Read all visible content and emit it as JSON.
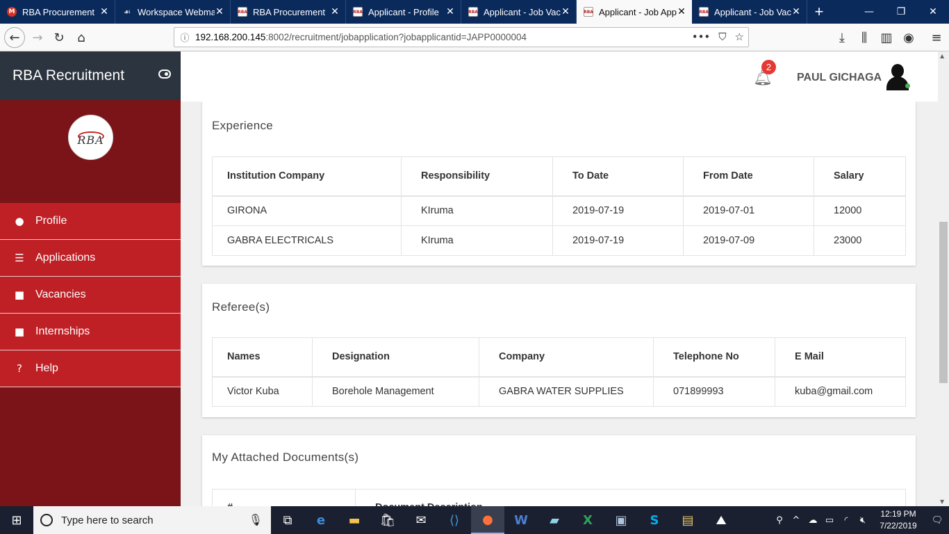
{
  "browser": {
    "tabs": [
      {
        "title": "RBA Procurement",
        "icon": "mail-icon"
      },
      {
        "title": "Workspace Webmail",
        "icon": "webmail-icon"
      },
      {
        "title": "RBA Procurement",
        "icon": "rba-favicon"
      },
      {
        "title": "Applicant - Profile",
        "icon": "rba-favicon"
      },
      {
        "title": "Applicant - Job Vacancy",
        "icon": "rba-favicon"
      },
      {
        "title": "Applicant - Job Application",
        "icon": "rba-favicon",
        "active": true
      },
      {
        "title": "Applicant - Job Vacancy",
        "icon": "rba-favicon"
      }
    ],
    "url_host": "192.168.200.145",
    "url_rest": ":8002/recruitment/jobapplication?jobapplicantid=JAPP0000004"
  },
  "sidebar": {
    "title": "RBA Recruitment",
    "logo_text": "RBA",
    "items": [
      {
        "label": "Profile",
        "icon": "user-circle-icon"
      },
      {
        "label": "Applications",
        "icon": "list-icon"
      },
      {
        "label": "Vacancies",
        "icon": "briefcase-icon"
      },
      {
        "label": "Internships",
        "icon": "briefcase-icon"
      },
      {
        "label": "Help",
        "icon": "question-circle-icon"
      }
    ],
    "colors": {
      "head": "#2c343f",
      "body": "#7b1418",
      "item": "#bf2025"
    }
  },
  "topbar": {
    "notification_count": "2",
    "user_name": "PAUL GICHAGA"
  },
  "experience": {
    "title": "Experience",
    "headers": [
      "Institution Company",
      "Responsibility",
      "To Date",
      "From Date",
      "Salary"
    ],
    "rows": [
      [
        "GIRONA",
        "KIruma",
        "2019-07-19",
        "2019-07-01",
        "12000"
      ],
      [
        "GABRA ELECTRICALS",
        "KIruma",
        "2019-07-19",
        "2019-07-09",
        "23000"
      ]
    ]
  },
  "referees": {
    "title": "Referee(s)",
    "headers": [
      "Names",
      "Designation",
      "Company",
      "Telephone No",
      "E Mail"
    ],
    "rows": [
      [
        "Victor Kuba",
        "Borehole Management",
        "GABRA WATER SUPPLIES",
        "071899993",
        "kuba@gmail.com"
      ]
    ]
  },
  "documents": {
    "title": "My Attached Documents(s)",
    "headers": [
      "#",
      "Document Description"
    ]
  },
  "taskbar": {
    "search_placeholder": "Type here to search",
    "time": "12:19 PM",
    "date": "7/22/2019"
  }
}
